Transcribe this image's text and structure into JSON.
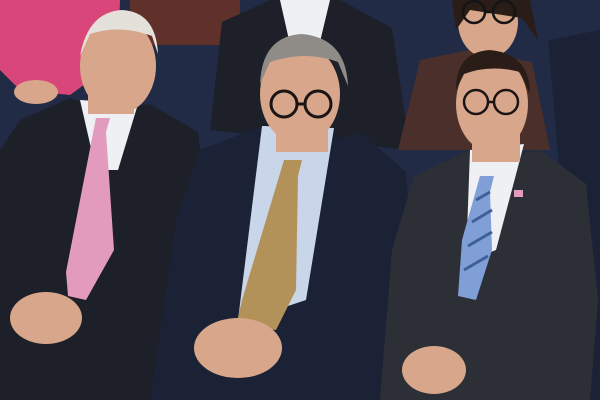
{
  "scene": {
    "colors": {
      "background": "#1a1e2a",
      "backdrop_navy": "#222b45",
      "bench_wood": "#6b3326",
      "suit_dark": "#1d2029",
      "suit_navy": "#1c2235",
      "suit_charcoal": "#2c2f36",
      "shirt_white": "#eef0f4",
      "shirt_light_blue": "#c9d6ea",
      "skin": "#d8a68a",
      "hair_white": "#e4e1da",
      "hair_grey": "#8f8c88",
      "hair_dark": "#2a1d17",
      "tie_pink": "#e29bbd",
      "tie_gold": "#b3925a",
      "tie_blue": "#7f9fd6",
      "jacket_pink": "#d9477a",
      "top_brown": "#4a2f2a"
    }
  }
}
